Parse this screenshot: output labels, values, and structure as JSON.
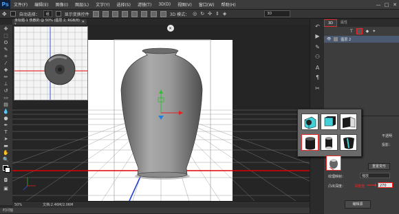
{
  "app": {
    "logo": "Ps"
  },
  "menu": [
    "文件(F)",
    "编辑(E)",
    "图像(I)",
    "图层(L)",
    "文字(Y)",
    "选择(S)",
    "滤镜(T)",
    "3D(D)",
    "视图(V)",
    "窗口(W)",
    "帮助(H)"
  ],
  "window_buttons": [
    "—",
    "□",
    "✕"
  ],
  "options": {
    "auto_select_label": "自动选择：",
    "auto_select_value": "组",
    "transform_label": "显示变换控件",
    "mode_label": "3D 模式：",
    "workspace_value": "3D"
  },
  "document": {
    "tab_title": "未标题-1 热敷的 @ 50% (图层 2, RGB/8) *",
    "close": "✕",
    "zoom": "50%",
    "doc_size": "文档:2.46M/2.06M"
  },
  "right_panel": {
    "tab_active": "3D",
    "tab_other": "属性",
    "filter_label": "T",
    "layer_name": "图层 2",
    "opacity_label": "不透明",
    "cast_label": "投影：",
    "texture_label": "纹理映射：",
    "texture_value": "缩放",
    "edit_source_label": "编辑源",
    "extrude_label": "凸出深度：",
    "extrude_value": "270",
    "annotation_text": "深度值",
    "reset_label": "重置变形",
    "bottom_button": "编辑源"
  },
  "timeline": {
    "label": "时间轴"
  },
  "accent_color": "#e52b2b"
}
